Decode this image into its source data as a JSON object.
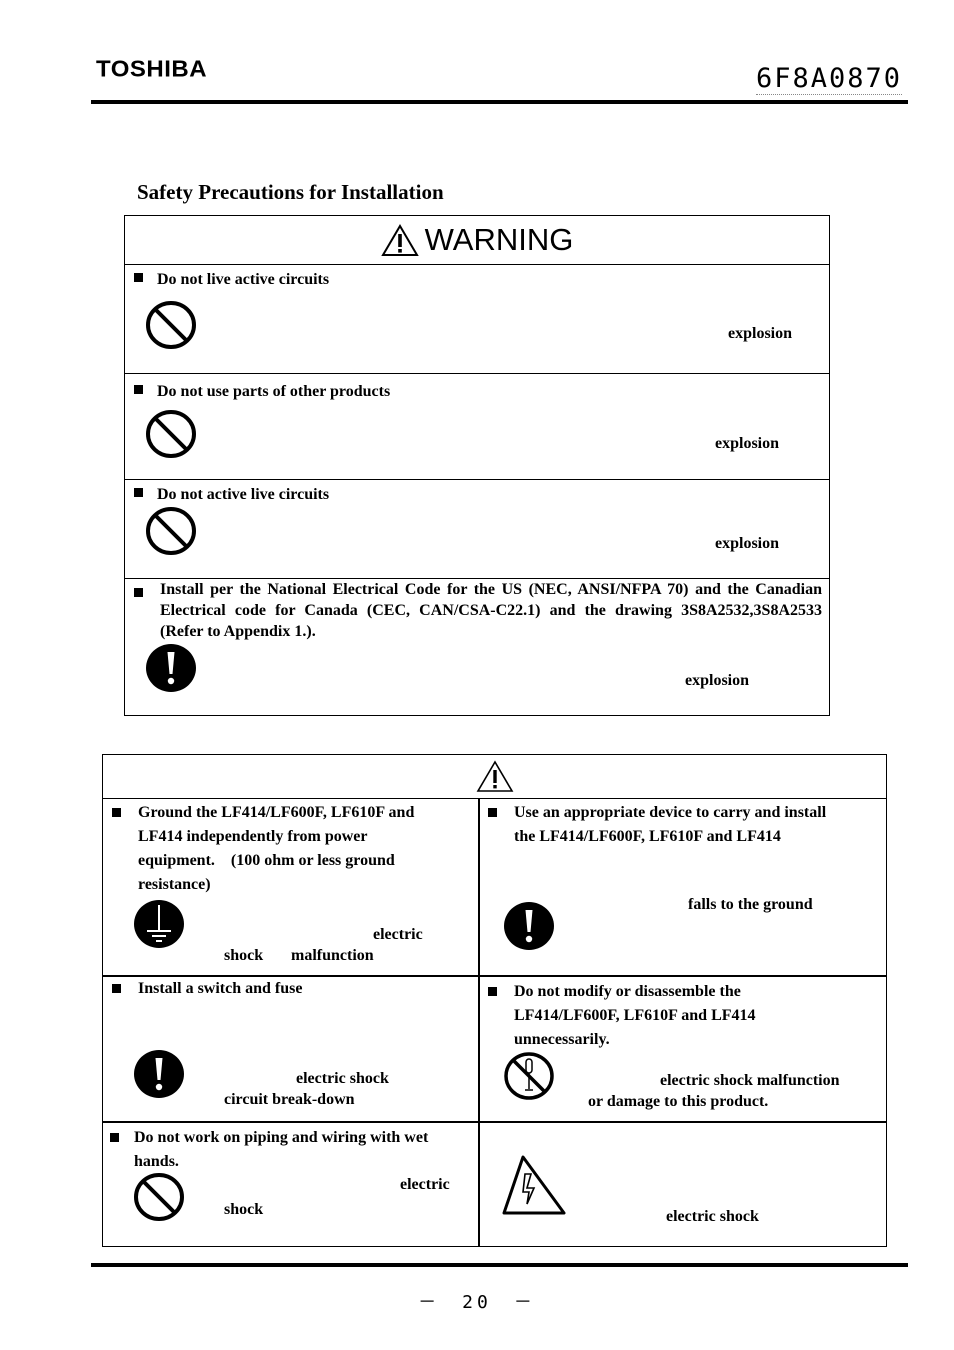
{
  "header": {
    "brand": "TOSHIBA",
    "document_number": "6F8A0870"
  },
  "section_title": "Safety Precautions for Installation",
  "warning": {
    "heading": "WARNING",
    "items": [
      {
        "title": "Do not live active circuits",
        "icon": "prohibition-icon",
        "consequence": "explosion"
      },
      {
        "title": "Do not use parts of other products",
        "icon": "prohibition-icon",
        "consequence": "explosion"
      },
      {
        "title": "Do not active live circuits",
        "icon": "prohibition-icon",
        "consequence": "explosion"
      },
      {
        "title": "Install per the National Electrical Code for the US (NEC, ANSI/NFPA 70) and the Canadian Electrical code for Canada (CEC, CAN/CSA-C22.1) and the drawing 3S8A2532,3S8A2533 (Refer to Appendix 1.).",
        "icon": "mandatory-action-icon",
        "consequence": "explosion"
      }
    ]
  },
  "caution": {
    "heading_icon": "caution-triangle-icon",
    "items": [
      {
        "title": "Ground the LF414/LF600F, LF610F and LF414 independently from power equipment.　(100 ohm or less ground resistance)",
        "title_lines": [
          "Ground the LF414/LF600F, LF610F and",
          "LF414 independently from power",
          "equipment.　(100 ohm or less ground",
          "resistance)"
        ],
        "icon": "ground-icon",
        "consequence_line1": "electric",
        "consequence_line2a": "shock",
        "consequence_line2b": "malfunction"
      },
      {
        "title_lines": [
          "Use an appropriate device to carry and install",
          "the LF414/LF600F, LF610F and LF414"
        ],
        "icon": "mandatory-action-icon",
        "consequence": "falls to the ground"
      },
      {
        "title_lines": [
          "Install a switch and fuse"
        ],
        "icon": "mandatory-action-icon",
        "consequence_line1": "electric shock",
        "consequence_line2": "circuit break-down"
      },
      {
        "title_lines": [
          "Do not modify or disassemble the",
          "LF414/LF600F, LF610F and LF414",
          "unnecessarily."
        ],
        "icon": "no-disassembly-icon",
        "consequence_line1": "electric shock  malfunction",
        "consequence_line2": "or damage to this product."
      },
      {
        "title_lines": [
          "Do not work on piping and wiring with wet",
          "hands."
        ],
        "icon": "prohibition-icon",
        "consequence_line1": "electric",
        "consequence_line2": "shock"
      },
      {
        "title_lines": [],
        "icon": "electric-shock-hazard-icon",
        "consequence": "electric shock"
      }
    ]
  },
  "footer": {
    "page_number": "－　20　－"
  }
}
